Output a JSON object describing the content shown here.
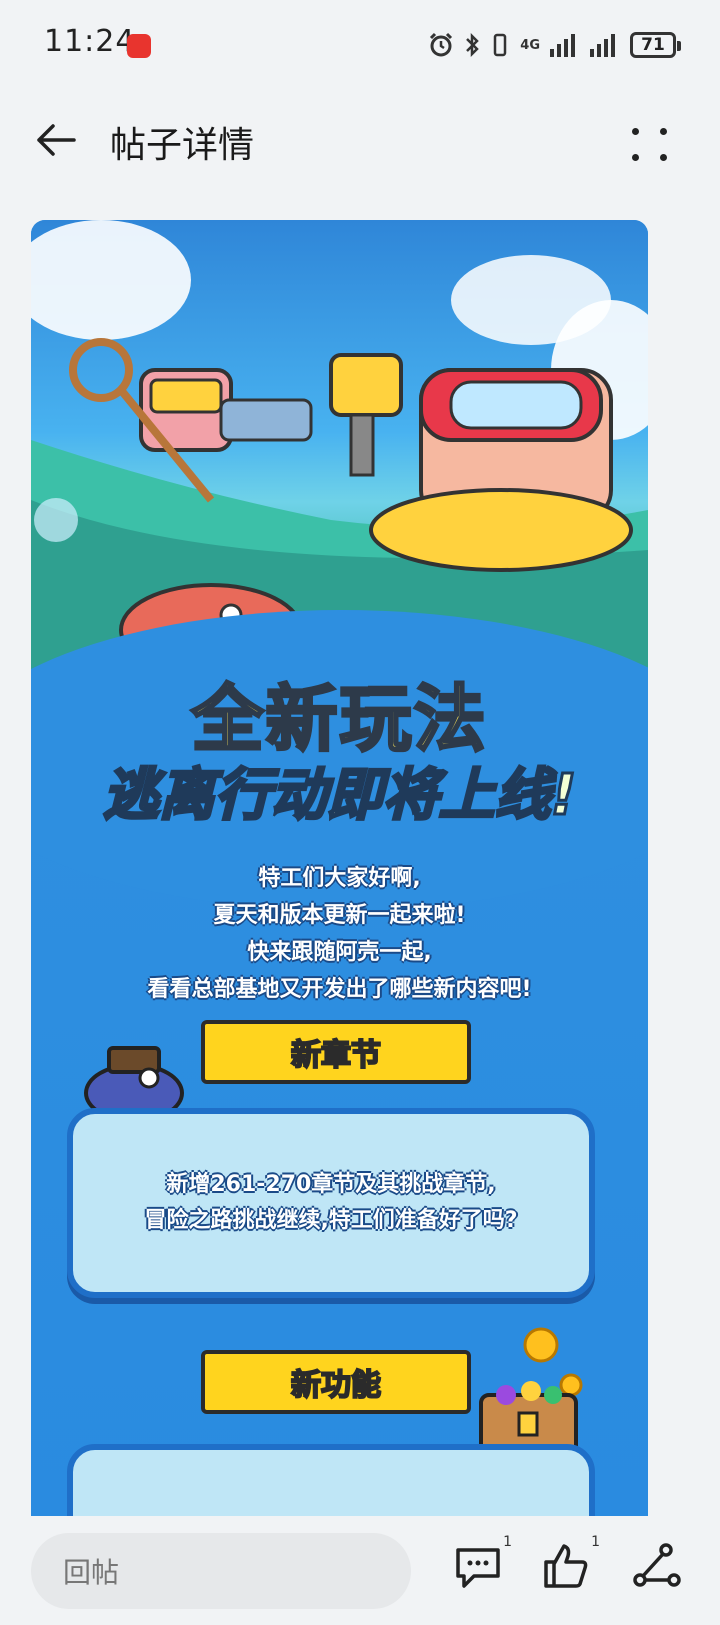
{
  "status_bar": {
    "time": "11:24",
    "network": "4G",
    "battery": "71"
  },
  "header": {
    "title": "帖子详情"
  },
  "poster": {
    "title_main": "全新玩法",
    "title_sub": "逃离行动即将上线!",
    "intro_lines": [
      "特工们大家好啊,",
      "夏天和版本更新一起来啦!",
      "快来跟随阿壳一起,",
      "看看总部基地又开发出了哪些新内容吧!"
    ],
    "section1": {
      "title": "新章节",
      "lines": [
        "新增261-270章节及其挑战章节,",
        "冒险之路挑战继续,特工们准备好了吗?"
      ]
    },
    "section2": {
      "title": "新功能"
    }
  },
  "bottom_bar": {
    "reply_placeholder": "回帖",
    "comment_count": "1",
    "like_count": "1"
  },
  "icons": {
    "back": "arrow-left-icon",
    "more": "more-vertical-icon",
    "comment": "comment-icon",
    "like": "thumbs-up-icon",
    "share": "share-icon"
  }
}
